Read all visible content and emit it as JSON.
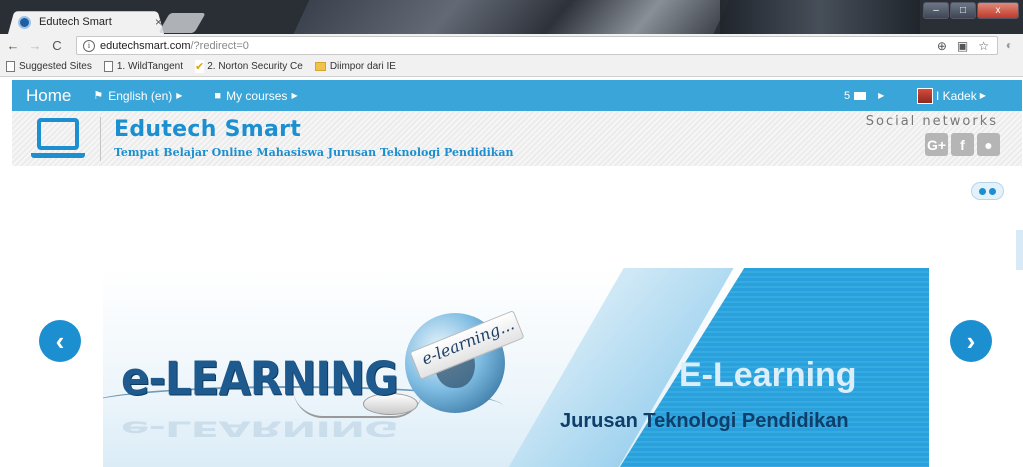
{
  "browser": {
    "tab_title": "Edutech Smart",
    "tab_close": "×",
    "url_host": "edutechsmart.com",
    "url_path": "/?redirect=0",
    "info_icon": "i",
    "window_controls": [
      "–",
      "□",
      "x"
    ]
  },
  "bookmarks": [
    {
      "label": "Suggested Sites",
      "icon": "page-icon"
    },
    {
      "label": "1. WildTangent",
      "icon": "page-icon"
    },
    {
      "label": "2. Norton Security Ce",
      "icon": "norton-check-icon"
    },
    {
      "label": "Diimpor dari IE",
      "icon": "folder-icon"
    }
  ],
  "navbar": {
    "home": "Home",
    "language": "English (en)",
    "courses": "My courses",
    "messages_count": "5",
    "user_name": "I Kadek"
  },
  "header": {
    "site_title": "Edutech Smart",
    "site_subtitle": "Tempat Belajar Online Mahasiswa Jurusan Teknologi Pendidikan",
    "social_label": "Social networks",
    "social_icons": [
      "G+",
      "f",
      "●"
    ]
  },
  "banner": {
    "logo_text": "e-LEARNING",
    "arrow_text": "e-learning...",
    "title": "E-Learning",
    "subtitle": "Jurusan Teknologi Pendidikan"
  },
  "colors": {
    "nav_blue": "#3aa5d8",
    "brand_blue": "#1b8fd0",
    "banner_blue": "#2aa1dc"
  }
}
